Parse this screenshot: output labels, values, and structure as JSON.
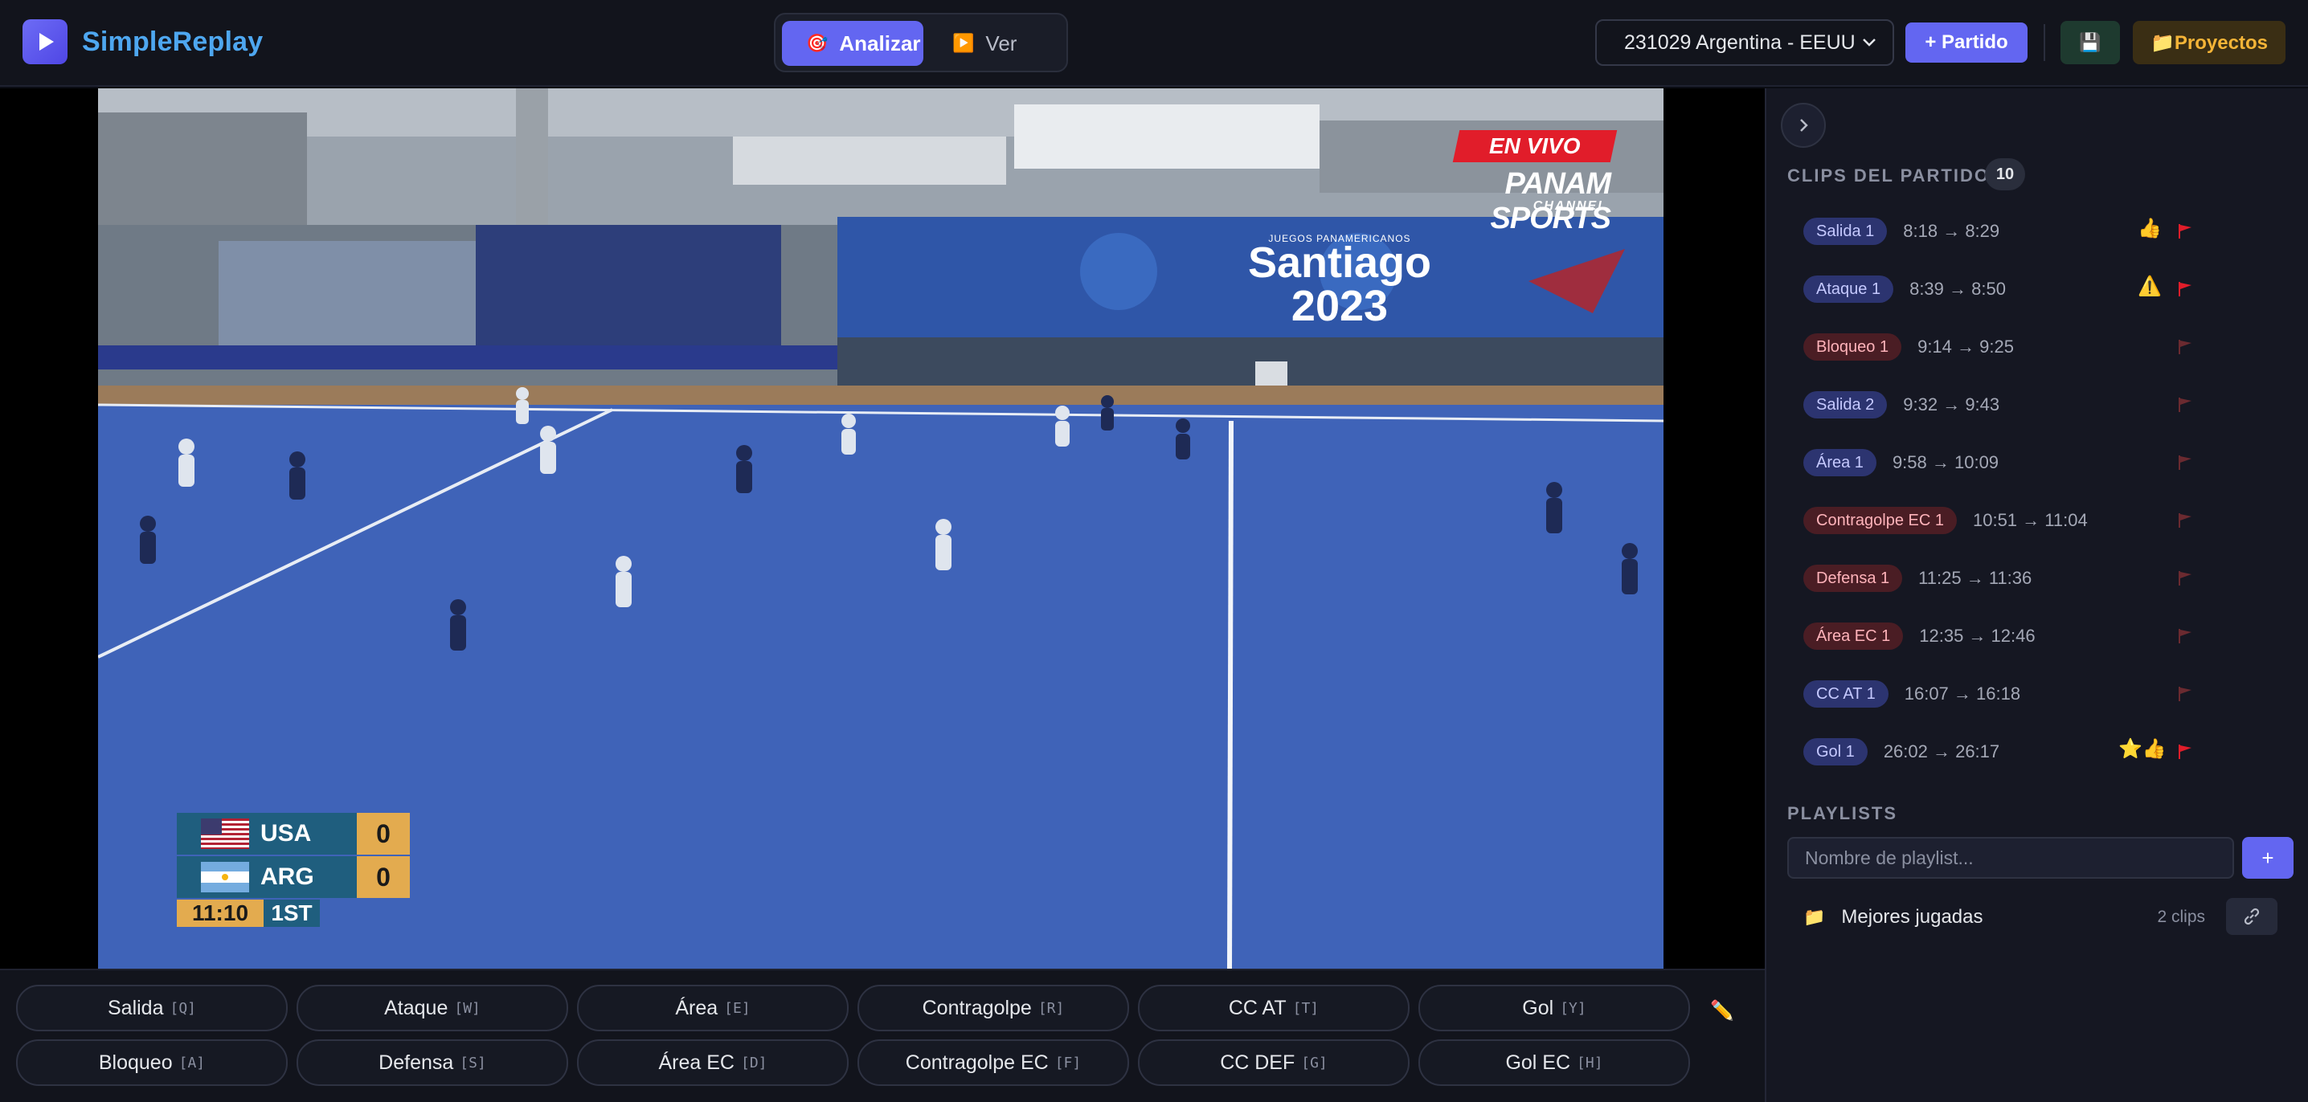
{
  "app": {
    "name": "SimpleReplay"
  },
  "modes": [
    {
      "label": "Analizar",
      "icon": "🎯",
      "active": true
    },
    {
      "label": "Ver",
      "icon": "▶️",
      "active": false
    }
  ],
  "header": {
    "selected_match": "231029 Argentina - EEUU",
    "add_match_label": "+ Partido",
    "save_icon": "💾",
    "projects_label": "📁Proyectos"
  },
  "broadcast": {
    "live_label": "EN VIVO",
    "channel_name": "PANAM SPORTS",
    "channel_sub": "CHANNEL",
    "board_title": "Santiago 2023",
    "board_sub": "JUEGOS PANAMERICANOS",
    "scoreboard": {
      "teams": [
        {
          "name": "USA",
          "score": "0"
        },
        {
          "name": "ARG",
          "score": "0"
        }
      ],
      "clock": "11:10",
      "period": "1ST"
    }
  },
  "tag_buttons": {
    "row1": [
      {
        "label": "Salida",
        "key": "[Q]"
      },
      {
        "label": "Ataque",
        "key": "[W]"
      },
      {
        "label": "Área",
        "key": "[E]"
      },
      {
        "label": "Contragolpe",
        "key": "[R]"
      },
      {
        "label": "CC AT",
        "key": "[T]"
      },
      {
        "label": "Gol",
        "key": "[Y]"
      }
    ],
    "row2": [
      {
        "label": "Bloqueo",
        "key": "[A]"
      },
      {
        "label": "Defensa",
        "key": "[S]"
      },
      {
        "label": "Área EC",
        "key": "[D]"
      },
      {
        "label": "Contragolpe EC",
        "key": "[F]"
      },
      {
        "label": "CC DEF",
        "key": "[G]"
      },
      {
        "label": "Gol EC",
        "key": "[H]"
      }
    ],
    "edit_icon": "✏️"
  },
  "clips_panel": {
    "title": "CLIPS DEL PARTIDO",
    "count": "10",
    "clips": [
      {
        "label": "Salida 1",
        "range": "8:18 → 8:29",
        "tone": "blue",
        "emoji": "👍",
        "flag_color": "#e11d2a"
      },
      {
        "label": "Ataque 1",
        "range": "8:39 → 8:50",
        "tone": "blue",
        "emoji": "⚠️",
        "flag_color": "#e11d2a"
      },
      {
        "label": "Bloqueo 1",
        "range": "9:14 → 9:25",
        "tone": "red",
        "emoji": "",
        "flag_color": "#6b2a30"
      },
      {
        "label": "Salida 2",
        "range": "9:32 → 9:43",
        "tone": "blue",
        "emoji": "",
        "flag_color": "#6b2a30"
      },
      {
        "label": "Área 1",
        "range": "9:58 → 10:09",
        "tone": "blue",
        "emoji": "",
        "flag_color": "#6b2a30"
      },
      {
        "label": "Contragolpe EC 1",
        "range": "10:51 → 11:04",
        "tone": "red",
        "emoji": "",
        "flag_color": "#6b2a30"
      },
      {
        "label": "Defensa 1",
        "range": "11:25 → 11:36",
        "tone": "red",
        "emoji": "",
        "flag_color": "#6b2a30"
      },
      {
        "label": "Área EC 1",
        "range": "12:35 → 12:46",
        "tone": "red",
        "emoji": "",
        "flag_color": "#6b2a30"
      },
      {
        "label": "CC AT 1",
        "range": "16:07 → 16:18",
        "tone": "blue",
        "emoji": "",
        "flag_color": "#6b2a30"
      },
      {
        "label": "Gol 1",
        "range": "26:02 → 26:17",
        "tone": "blue",
        "emoji": "⭐👍",
        "flag_color": "#e11d2a"
      }
    ]
  },
  "playlists": {
    "title": "PLAYLISTS",
    "input_placeholder": "Nombre de playlist...",
    "add_label": "+",
    "items": [
      {
        "name": "Mejores jugadas",
        "count": "2 clips"
      }
    ]
  },
  "colors": {
    "accent": "#6366f1",
    "brand_text": "#4ea7f0",
    "pitch": "#3f63b8",
    "flag_active": "#e11d2a"
  }
}
